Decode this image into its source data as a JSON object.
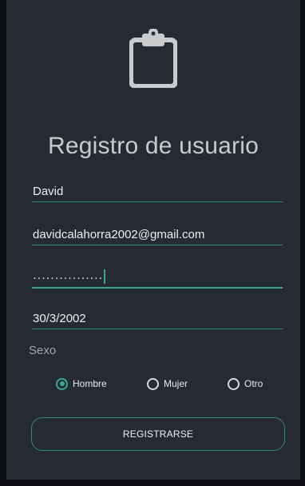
{
  "form": {
    "title": "Registro de usuario",
    "name_value": "David",
    "email_value": "davidcalahorra2002@gmail.com",
    "password_mask": "················",
    "birthdate_value": "30/3/2002",
    "sex_label": "Sexo",
    "sex_options": [
      "Hombre",
      "Mujer",
      "Otro"
    ],
    "selected_sex": "Hombre",
    "submit_label": "REGISTRARSE"
  },
  "colors": {
    "background": "#252a33",
    "accent": "#3aa696",
    "text": "#eef0f0",
    "logo": "#c8cacc"
  },
  "icons": {
    "logo": "clipboard-icon"
  }
}
